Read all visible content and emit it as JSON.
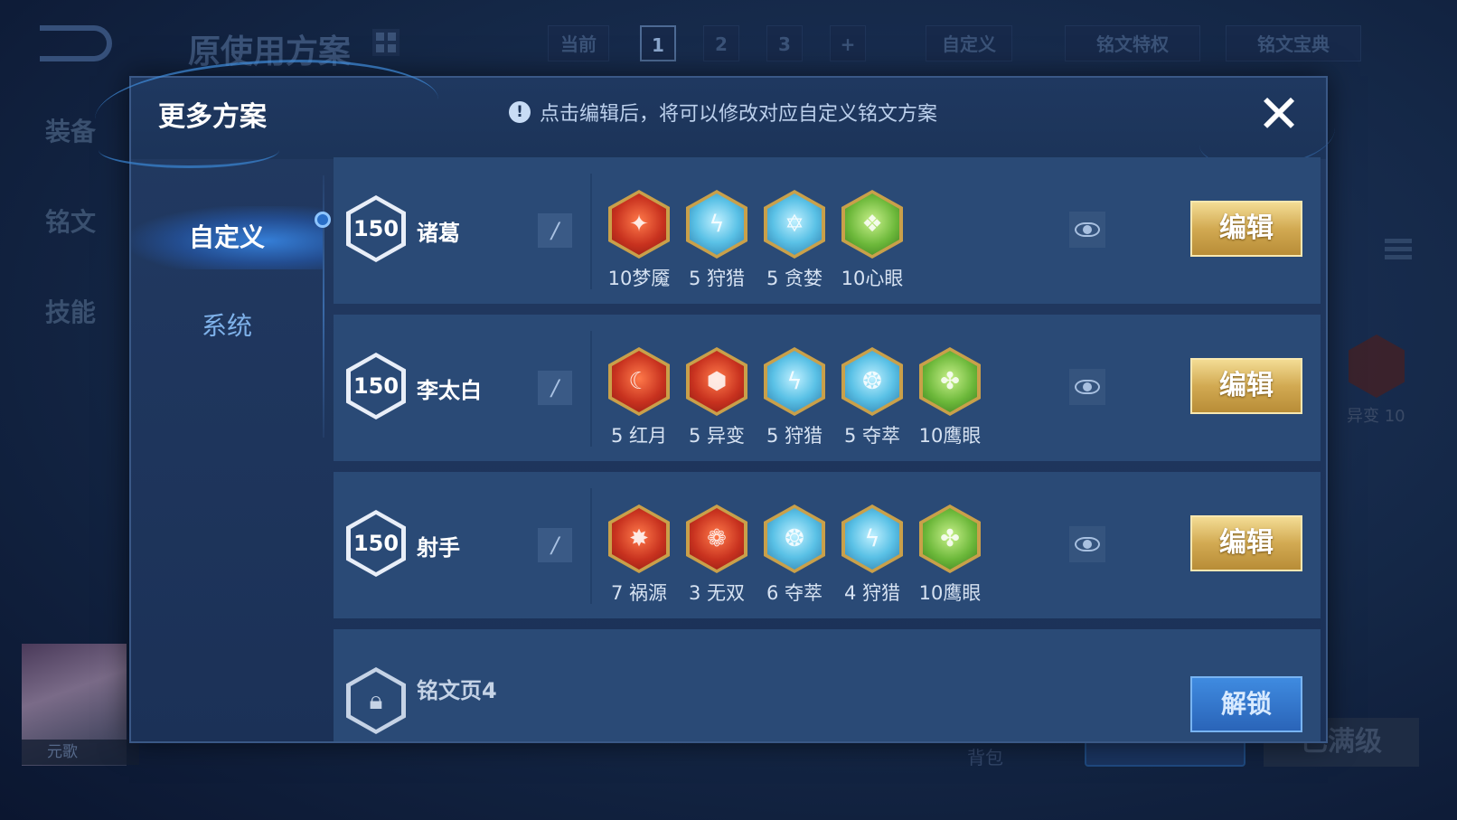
{
  "background": {
    "title": "原使用方案",
    "tabs": [
      "当前",
      "1",
      "2",
      "3",
      "+",
      "自定义"
    ],
    "badges": [
      "铭文特权",
      "铭文宝典"
    ],
    "side_menu": [
      "装备",
      "铭文",
      "技能"
    ],
    "hero_name": "元歌",
    "right_rune_label": "异变 10",
    "bag_label": "背包",
    "max_label": "已满级"
  },
  "modal": {
    "title": "更多方案",
    "hint": "点击编辑后，将可以修改对应自定义铭文方案",
    "close_icon": "close-icon",
    "tabs": [
      {
        "label": "自定义",
        "active": true
      },
      {
        "label": "系统",
        "active": false
      }
    ],
    "plans": [
      {
        "level": "150",
        "name": "诸葛",
        "runes": [
          {
            "label": "10梦魇",
            "color": "red"
          },
          {
            "label": "5 狩猎",
            "color": "blue"
          },
          {
            "label": "5 贪婪",
            "color": "blue"
          },
          {
            "label": "10心眼",
            "color": "green"
          }
        ],
        "edit_label": "编辑"
      },
      {
        "level": "150",
        "name": "李太白",
        "runes": [
          {
            "label": "5 红月",
            "color": "red"
          },
          {
            "label": "5 异变",
            "color": "red"
          },
          {
            "label": "5 狩猎",
            "color": "blue"
          },
          {
            "label": "5 夺萃",
            "color": "blue"
          },
          {
            "label": "10鹰眼",
            "color": "green"
          }
        ],
        "edit_label": "编辑"
      },
      {
        "level": "150",
        "name": "射手",
        "runes": [
          {
            "label": "7 祸源",
            "color": "red"
          },
          {
            "label": "3 无双",
            "color": "red"
          },
          {
            "label": "6 夺萃",
            "color": "blue"
          },
          {
            "label": "4 狩猎",
            "color": "blue"
          },
          {
            "label": "10鹰眼",
            "color": "green"
          }
        ],
        "edit_label": "编辑"
      }
    ],
    "locked_plan": {
      "name": "铭文页4",
      "unlock_label": "解锁"
    }
  }
}
